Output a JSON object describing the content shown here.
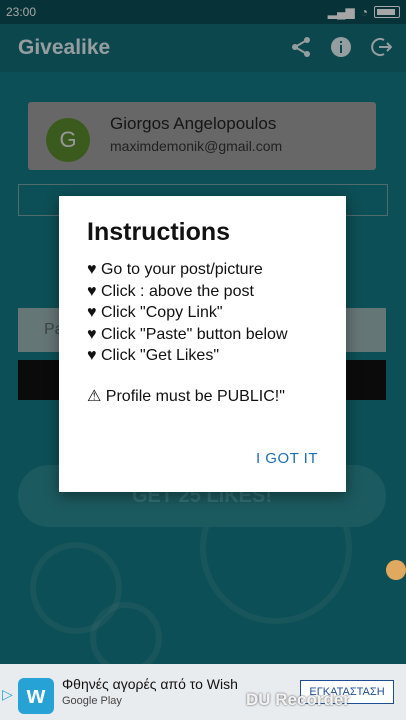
{
  "statusbar": {
    "time": "23:00",
    "icons": [
      "signal-icon",
      "wifi-icon",
      "battery-icon"
    ]
  },
  "appbar": {
    "title": "Givealike",
    "actions": [
      "share-icon",
      "info-icon",
      "logout-icon"
    ]
  },
  "profile": {
    "initial": "G",
    "name": "Giorgos Angelopoulos",
    "email": "maximdemonik@gmail.com"
  },
  "main": {
    "paste_placeholder": "Pa",
    "get_likes_label": "GET 25 LIKES!"
  },
  "dialog": {
    "title": "Instructions",
    "lines": [
      "♥ Go to your post/picture",
      "♥ Click : above the post",
      "♥ Click \"Copy Link\"",
      "♥ Click \"Paste\" button below",
      "♥ Click \"Get Likes\""
    ],
    "warning": "⚠ Profile must be PUBLIC!\"",
    "ok_label": "I GOT IT"
  },
  "ad": {
    "logo": "w",
    "text": "Φθηνές αγορές από το Wish",
    "sub": "Google Play",
    "install": "ΕΓΚΑΤΑΣΤΑΣΗ"
  },
  "watermark": "DU Recorder",
  "colors": {
    "appbar": "#156e78",
    "accent": "#1d6fb3",
    "background": "#157a84"
  }
}
